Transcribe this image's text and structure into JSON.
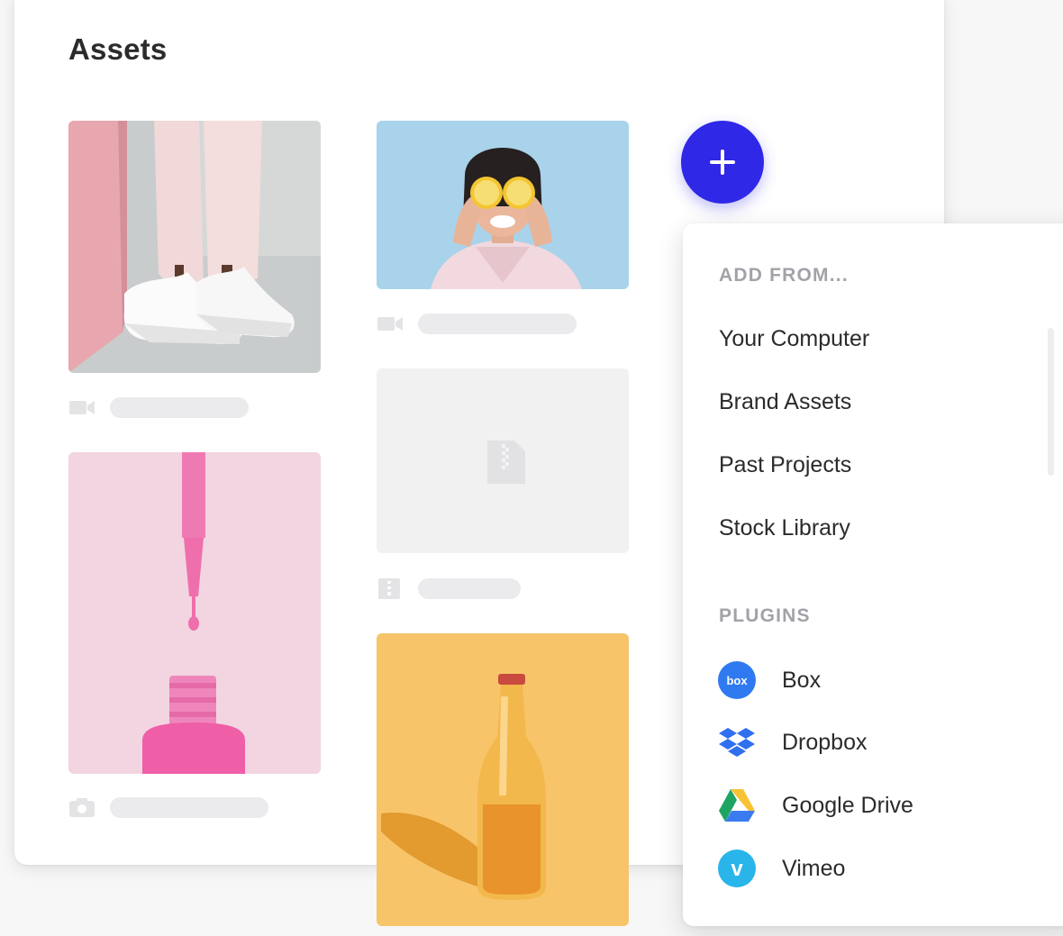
{
  "page": {
    "title": "Assets"
  },
  "colors": {
    "accent": "#2f28e6",
    "placeholder_bar": "#ebebed",
    "section_label": "#a2a2a8"
  },
  "assets": [
    {
      "kind": "video",
      "icon": "video-camera-icon",
      "thumbnail": "white sneakers on grey floor"
    },
    {
      "kind": "video",
      "icon": "video-camera-icon",
      "thumbnail": "woman holding lemon slices over eyes"
    },
    {
      "kind": "photo",
      "icon": "camera-icon",
      "thumbnail": "pink nail polish bottle with drip"
    },
    {
      "kind": "archive",
      "icon": "zip-file-icon",
      "thumbnail": ""
    },
    {
      "kind": "photo",
      "icon": "camera-icon",
      "thumbnail": "glass bottle on yellow background"
    }
  ],
  "add_button": {
    "icon": "plus-icon"
  },
  "dropdown": {
    "add_from_label": "ADD FROM...",
    "sources": [
      {
        "label": "Your Computer"
      },
      {
        "label": "Brand Assets"
      },
      {
        "label": "Past Projects"
      },
      {
        "label": "Stock Library"
      }
    ],
    "plugins_label": "PLUGINS",
    "plugins": [
      {
        "label": "Box",
        "icon": "box-icon",
        "icon_text": "box",
        "color": "#2f7af0"
      },
      {
        "label": "Dropbox",
        "icon": "dropbox-icon",
        "color": "#2f6ff0"
      },
      {
        "label": "Google Drive",
        "icon": "google-drive-icon",
        "color": "#1fa463"
      },
      {
        "label": "Vimeo",
        "icon": "vimeo-icon",
        "icon_text": "v",
        "color": "#29b4ea"
      }
    ]
  }
}
